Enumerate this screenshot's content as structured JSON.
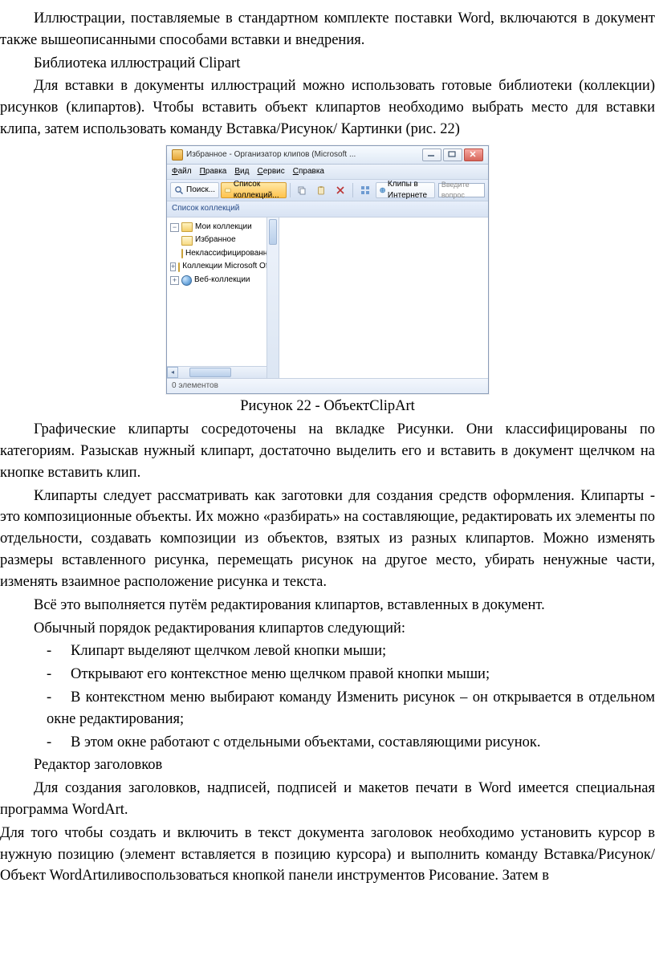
{
  "para1": "Иллюстрации, поставляемые в стандартном комплекте поставки Word, включаются в документ также вышеописанными способами вставки и внедрения.",
  "para2": "Библиотека иллюстраций Clipart",
  "para3": "Для вставки в документы иллюстраций можно использовать готовые библиотеки (коллекции) рисунков (клипартов). Чтобы вставить объект клипартов необходимо выбрать место для вставки клипа, затем использовать команду Вставка/Рисунок/ Картинки (рис. 22)",
  "caption": "Рисунок 22 -  ОбъектClipArt",
  "para4": "Графические клипарты сосредоточены на вкладке Рисунки. Они классифицированы по категориям. Разыскав нужный клипарт, достаточно выделить его и вставить в документ щелчком на кнопке вставить клип.",
  "para5": "Клипарты следует рассматривать как заготовки для создания средств оформления. Клипарты - это композиционные объекты. Их можно «разбирать» на составляющие, редактировать их элементы по отдельности, создавать композиции из объектов, взятых из разных клипартов. Можно изменять размеры вставленного рисунка, перемещать рисунок на другое место, убирать ненужные части, изменять взаимное расположение рисунка и текста.",
  "para6": "Всё это выполняется путём редактирования клипартов, вставленных  в документ.",
  "para7": "Обычный порядок редактирования клипартов следующий:",
  "b1": "Клипарт выделяют щелчком левой кнопки мыши;",
  "b2": "Открывают его контекстное меню щелчком правой кнопки мыши;",
  "b3": "В контекстном меню выбирают команду Изменить рисунок – он открывается в отдельном окне редактирования;",
  "b4": "В этом окне работают с отдельными объектами, составляющими рисунок.",
  "para8": "Редактор заголовков",
  "para9": "Для создания заголовков, надписей, подписей и макетов печати в Word имеется специальная программа WordArt.",
  "para10": "Для  того чтобы создать и включить в текст документа заголовок необходимо установить курсор в нужную позицию (элемент вставляется в позицию курсора) и выполнить команду Вставка/Рисунок/Объект WordArtиливоспользоваться кнопкой панели инструментов Рисование. Затем в",
  "win": {
    "title": "Избранное - Организатор клипов (Microsoft ...",
    "menu": {
      "file": "Файл",
      "edit": "Правка",
      "view": "Вид",
      "service": "Сервис",
      "help": "Справка"
    },
    "toolbar": {
      "search": "Поиск...",
      "collections": "Список коллекций...",
      "clipsOnline": "Клипы в Интернете",
      "askPlaceholder": "Введите вопрос"
    },
    "crumb": "Список коллекций",
    "tree": {
      "root": "Мои коллекции",
      "fav": "Избранное",
      "uncls": "Неклассифицированные к",
      "msoffice": "Коллекции Microsoft Office",
      "web": "Веб-коллекции"
    },
    "status": "0 элементов"
  }
}
